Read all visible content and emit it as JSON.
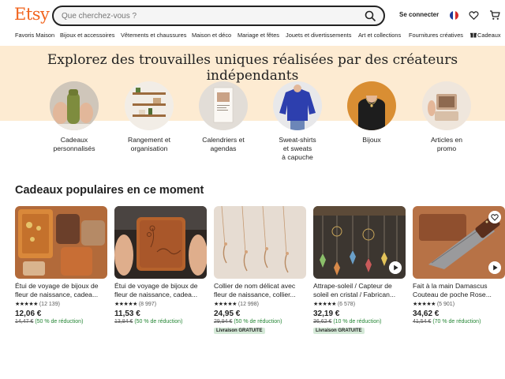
{
  "header": {
    "logo": "Etsy",
    "search_placeholder": "Que cherchez-vous ?",
    "signin_label": "Se connecter"
  },
  "nav": {
    "categories": [
      "Favoris Maison",
      "Bijoux et accessoires",
      "Vêtements et chaussures",
      "Maison et déco",
      "Mariage et fêtes",
      "Jouets et divertissements",
      "Art et collections",
      "Fournitures créatives",
      "Cadeaux"
    ]
  },
  "hero": {
    "title": "Explorez des trouvailles uniques réalisées par des créateurs indépendants",
    "circles": [
      {
        "label_lines": [
          "Cadeaux",
          "personnalisés"
        ]
      },
      {
        "label_lines": [
          "Rangement et",
          "organisation"
        ]
      },
      {
        "label_lines": [
          "Calendriers et",
          "agendas"
        ]
      },
      {
        "label_lines": [
          "Sweat-shirts",
          "et sweats",
          "à capuche"
        ]
      },
      {
        "label_lines": [
          "Bijoux"
        ]
      },
      {
        "label_lines": [
          "Articles en",
          "promo"
        ]
      }
    ]
  },
  "popular": {
    "title": "Cadeaux populaires en ce moment",
    "items": [
      {
        "title_lines": [
          "Étui de voyage de bijoux de",
          "fleur de naissance, cadea..."
        ],
        "stars": "★★★★★",
        "reviews": "(12 139)",
        "price": "12,06 €",
        "old_price": "14,47 €",
        "discount": "(50 % de réduction)",
        "badge": ""
      },
      {
        "title_lines": [
          "Étui de voyage de bijoux de",
          "fleur de naissance, cadea..."
        ],
        "stars": "★★★★★",
        "reviews": "(8 997)",
        "price": "11,53 €",
        "old_price": "13,84 €",
        "discount": "(50 % de réduction)",
        "badge": ""
      },
      {
        "title_lines": [
          "Collier de nom délicat avec",
          "fleur de naissance, collier..."
        ],
        "stars": "★★★★★",
        "reviews": "(12 998)",
        "price": "24,95 €",
        "old_price": "29,94 €",
        "discount": "(50 % de réduction)",
        "badge": "Livraison GRATUITE"
      },
      {
        "title_lines": [
          "Attrape-soleil / Capteur de",
          "soleil en cristal / Fabrican..."
        ],
        "stars": "★★★★★",
        "reviews": "(6 578)",
        "price": "32,19 €",
        "old_price": "36,62 €",
        "discount": "(10 % de réduction)",
        "badge": "Livraison GRATUITE"
      },
      {
        "title_lines": [
          "Fait à la main Damascus",
          "Couteau de poche Rose..."
        ],
        "stars": "★★★★★",
        "reviews": "(5 901)",
        "price": "34,62 €",
        "old_price": "41,54 €",
        "discount": "(70 % de réduction)",
        "badge": ""
      }
    ]
  },
  "colors": {
    "brand": "#f1641e",
    "hero_bg": "#fdebd2",
    "discount_green": "#258635",
    "badge_bg": "#d4e9d7"
  },
  "icons": [
    "search-icon",
    "flag-fr-icon",
    "heart-icon",
    "cart-icon",
    "gift-icon",
    "play-icon",
    "favorite-heart-icon"
  ]
}
